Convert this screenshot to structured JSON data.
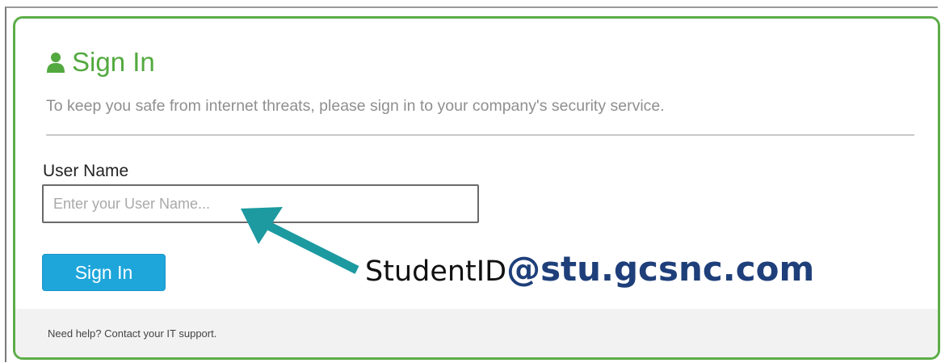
{
  "login": {
    "title": "Sign In",
    "subtitle": "To keep you safe from internet threats, please sign in to your company's security service.",
    "username_label": "User Name",
    "username_placeholder": "Enter your User Name...",
    "username_value": "",
    "signin_label": "Sign In",
    "help_text": "Need help? Contact your IT support."
  },
  "annotation": {
    "prefix": "StudentID",
    "domain": "@stu.gcsnc.com"
  },
  "icons": {
    "title_icon": "user-icon",
    "annotation_arrow": "arrow-icon"
  },
  "colors": {
    "accent_green": "#5cad48",
    "button_blue": "#1ea6db",
    "arrow_teal": "#1c9aa0",
    "annotation_navy": "#1e3f7a"
  }
}
